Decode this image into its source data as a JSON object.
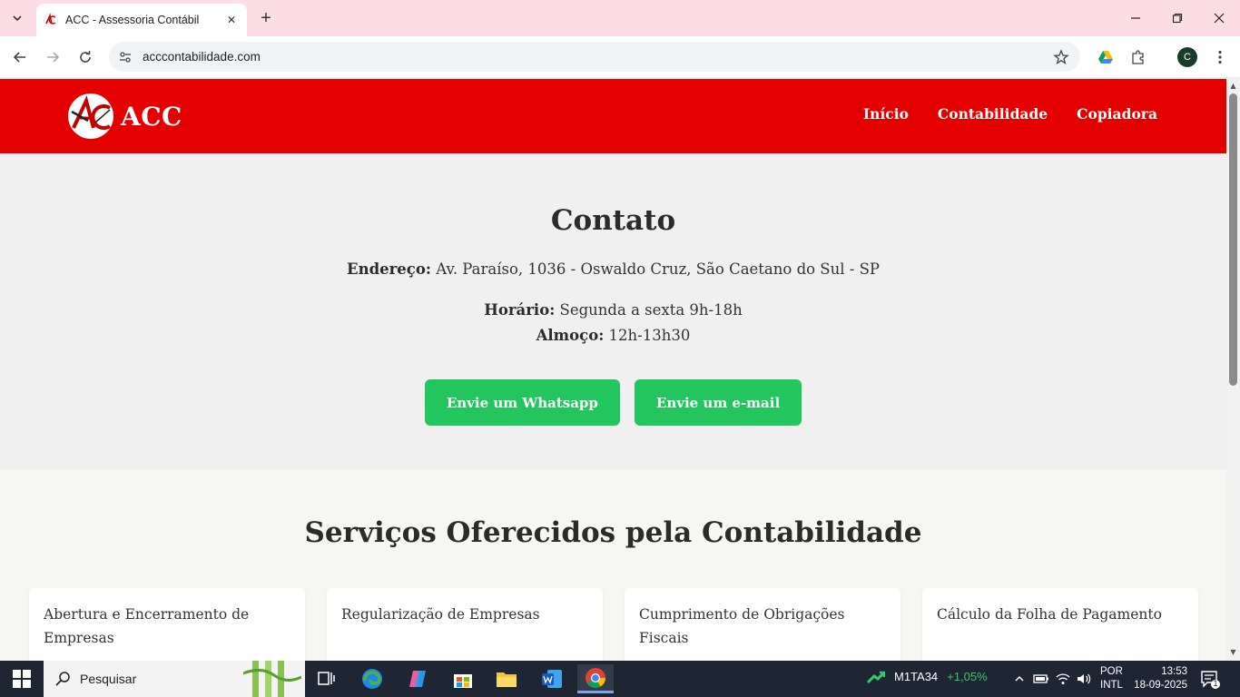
{
  "browser": {
    "tab_title": "ACC - Assessoria Contábil",
    "url": "acccontabilidade.com",
    "profile_initial": "C"
  },
  "site": {
    "logo_text": "ACC",
    "nav": [
      "Início",
      "Contabilidade",
      "Copiadora"
    ],
    "brand_color": "#e50000"
  },
  "contact": {
    "title": "Contato",
    "address_label": "Endereço:",
    "address_value": "Av. Paraíso, 1036 - Oswaldo Cruz, São Caetano do Sul - SP",
    "hours_label": "Horário:",
    "hours_value": "Segunda a sexta 9h-18h",
    "lunch_label": "Almoço:",
    "lunch_value": "12h-13h30",
    "whatsapp_button": "Envie um Whatsapp",
    "email_button": "Envie um e-mail",
    "button_color": "#22c55e"
  },
  "services": {
    "title": "Serviços Oferecidos pela Contabilidade",
    "cards": [
      "Abertura e Encerramento de Empresas",
      "Regularização de Empresas",
      "Cumprimento de Obrigações Fiscais",
      "Cálculo da Folha de Pagamento"
    ]
  },
  "taskbar": {
    "search_placeholder": "Pesquisar",
    "ticker_symbol": "M1TA34",
    "ticker_change": "+1,05%",
    "lang_line1": "POR",
    "lang_line2": "INTL",
    "time": "13:53",
    "date": "18-09-2025",
    "notification_count": "1"
  }
}
